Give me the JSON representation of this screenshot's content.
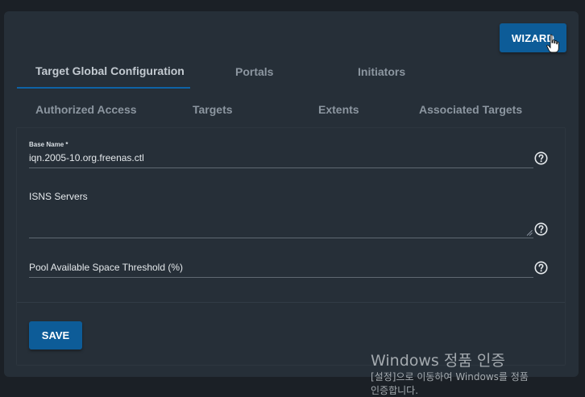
{
  "toolbar": {
    "wizard_label": "WIZARD"
  },
  "tabs": [
    {
      "label": "Target Global Configuration",
      "active": true
    },
    {
      "label": "Portals"
    },
    {
      "label": "Initiators"
    },
    {
      "label": "Authorized Access"
    },
    {
      "label": "Targets"
    },
    {
      "label": "Extents"
    },
    {
      "label": "Associated Targets"
    }
  ],
  "form": {
    "base_name": {
      "label": "Base Name *",
      "value": "iqn.2005-10.org.freenas.ctl"
    },
    "isns_servers": {
      "label": "ISNS Servers",
      "value": ""
    },
    "pool_threshold": {
      "label": "Pool Available Space Threshold (%)",
      "value": ""
    }
  },
  "actions": {
    "save_label": "SAVE"
  },
  "watermark": {
    "title": "Windows 정품 인증",
    "line1": "[설정]으로 이동하여 Windows를 정품",
    "line2": "인증합니다."
  },
  "icons": {
    "help": "help-circle-icon",
    "resize": "resize-grip-icon",
    "cursor": "hand-pointer-icon"
  },
  "colors": {
    "accent": "#0d5c98",
    "tab_underline": "#0e63a6",
    "card": "#262f38",
    "background": "#1b2026"
  }
}
